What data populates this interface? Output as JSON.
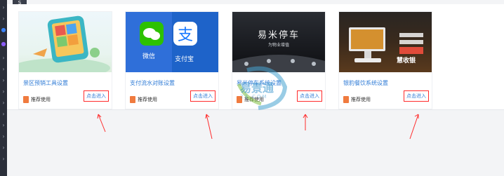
{
  "top_badge": "S",
  "cards": [
    {
      "title": "景区预销工具设置",
      "tag": "推荐使用",
      "enter": "点击进入",
      "icon": "app-phone-icon",
      "accent": "#2f7bd6"
    },
    {
      "title": "支付流水对账设置",
      "tag": "推荐使用",
      "enter": "点击进入",
      "icon": "wechat-alipay-icon",
      "labels": {
        "wechat": "微信",
        "alipay": "支付宝"
      }
    },
    {
      "title": "易米停车系统设置",
      "tag": "推荐使用",
      "enter": "点击进入",
      "icon": "parking-icon",
      "banner": {
        "main": "易米停车",
        "sub": "为物业增值"
      }
    },
    {
      "title": "银豹餐饮系统设置",
      "tag": "推荐使用",
      "enter": "点击进入",
      "icon": "pos-terminal-icon",
      "banner": {
        "main": "慧收银"
      }
    }
  ],
  "watermark": {
    "text": "易景通",
    "sub": "23 COM"
  },
  "colors": {
    "link": "#2f7bd6",
    "highlight_box": "#ff2b2b",
    "tag": "#f07b3f",
    "sidebar": "#2b2f3a"
  }
}
